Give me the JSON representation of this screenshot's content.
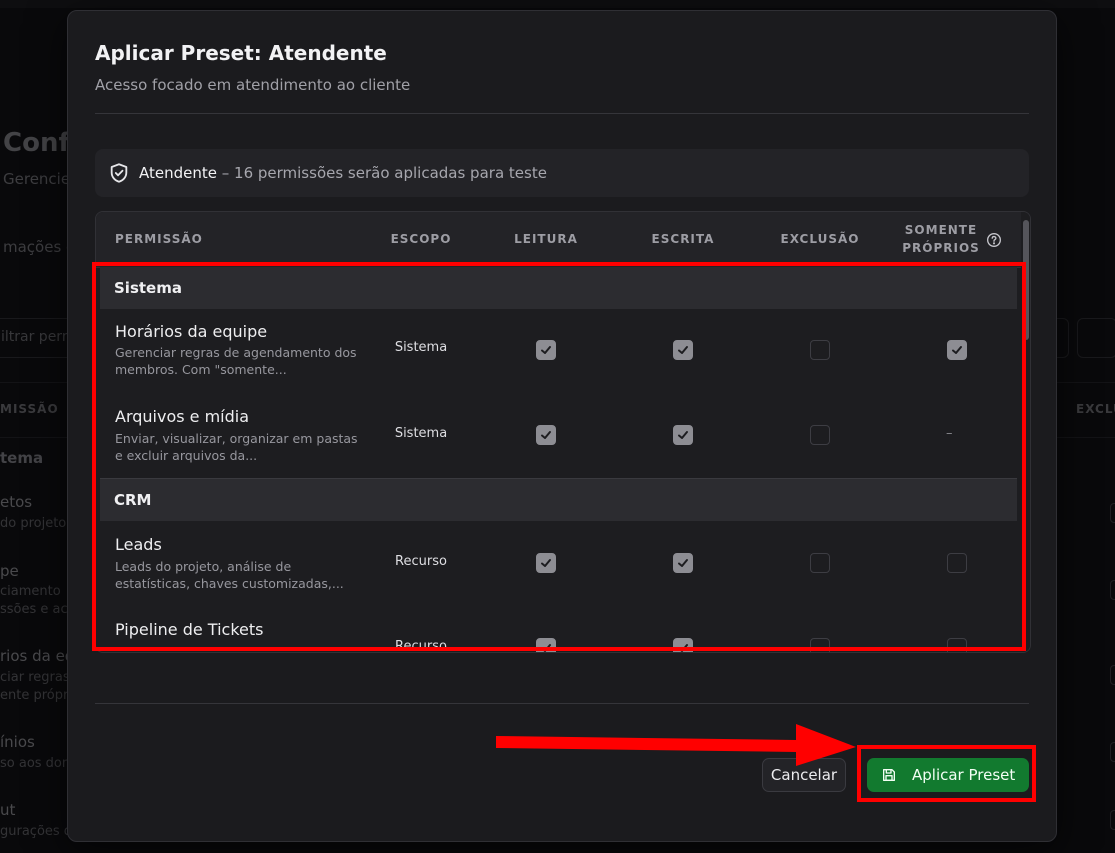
{
  "background": {
    "title": "Confi",
    "subtitle": "Gerencie",
    "tab": "mações g",
    "filter_placeholder": "iltrar perm",
    "col_permission": "MISSÃO",
    "col_exclusion": "EXCLU",
    "group": "tema",
    "items": [
      {
        "name": "etos",
        "desc1": "do projeto",
        "desc2": ""
      },
      {
        "name": "pe",
        "desc1": "ciamento",
        "desc2": "ssões e ac"
      },
      {
        "name": "rios da eq",
        "desc1": "ciar regras",
        "desc2": "ente própr"
      },
      {
        "name": "ínios",
        "desc1": "so aos dom",
        "desc2": ""
      },
      {
        "name": "ut",
        "desc1": "gurações d",
        "desc2": ""
      }
    ]
  },
  "modal": {
    "title": "Aplicar Preset: Atendente",
    "subtitle": "Acesso focado em atendimento ao cliente",
    "info": {
      "name": "Atendente",
      "rest": " – 16 permissões serão aplicadas para teste"
    },
    "headers": {
      "permission": "PERMISSÃO",
      "scope": "ESCOPO",
      "read": "LEITURA",
      "write": "ESCRITA",
      "delete": "EXCLUSÃO",
      "own_line1": "SOMENTE",
      "own_line2": "PRÓPRIOS"
    },
    "groups": [
      {
        "name": "Sistema",
        "rows": [
          {
            "name": "Horários da equipe",
            "desc": "Gerenciar regras de agendamento dos membros. Com \"somente...",
            "scope": "Sistema",
            "read": true,
            "write": true,
            "delete": false,
            "own": true
          },
          {
            "name": "Arquivos e mídia",
            "desc": "Enviar, visualizar, organizar em pastas e excluir arquivos da...",
            "scope": "Sistema",
            "read": true,
            "write": true,
            "delete": false,
            "own": null,
            "own_text": "–"
          }
        ]
      },
      {
        "name": "CRM",
        "rows": [
          {
            "name": "Leads",
            "desc": "Leads do projeto, análise de estatísticas, chaves customizadas,...",
            "scope": "Recurso",
            "read": true,
            "write": true,
            "delete": false,
            "own": false
          },
          {
            "name": "Pipeline de Tickets",
            "desc": "",
            "scope": "Recurso",
            "read": true,
            "write": true,
            "delete": false,
            "own": false
          }
        ]
      }
    ],
    "buttons": {
      "cancel": "Cancelar",
      "apply": "Aplicar Preset"
    }
  },
  "icons": {
    "shield": "shield-check-icon",
    "help": "help-circle-icon",
    "save": "save-icon",
    "check": "check-icon"
  },
  "colors": {
    "accent": "#127a2f",
    "highlight": "#ff0000"
  }
}
